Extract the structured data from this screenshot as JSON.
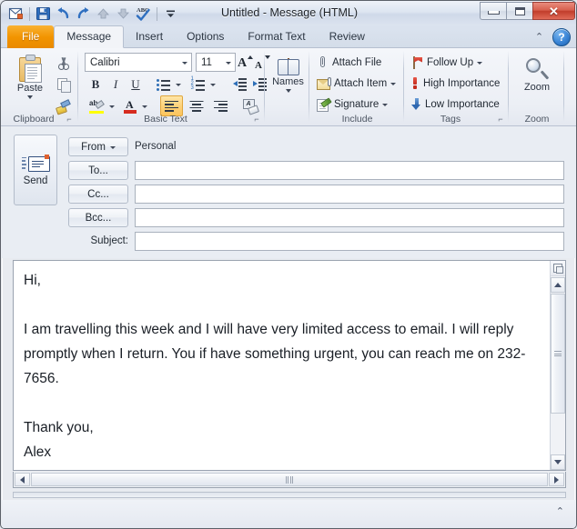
{
  "window": {
    "title": "Untitled  -  Message (HTML)",
    "controls": {
      "minimize": "Minimize",
      "maximize": "Maximize",
      "close": "Close",
      "close_glyph": "✕"
    }
  },
  "quick_access": [
    {
      "name": "outlook-item-icon",
      "title": "Outlook Item"
    },
    {
      "name": "save-icon",
      "title": "Save"
    },
    {
      "name": "undo-icon",
      "title": "Undo"
    },
    {
      "name": "redo-icon",
      "title": "Redo"
    },
    {
      "name": "previous-item-icon",
      "title": "Previous Item"
    },
    {
      "name": "next-item-icon",
      "title": "Next Item"
    },
    {
      "name": "spelling-icon",
      "title": "Spelling & Grammar"
    },
    {
      "name": "customize-qat-icon",
      "title": "Customize Quick Access Toolbar"
    }
  ],
  "tabs": [
    {
      "label": "File",
      "state": "file"
    },
    {
      "label": "Message",
      "state": "selected"
    },
    {
      "label": "Insert",
      "state": "normal"
    },
    {
      "label": "Options",
      "state": "normal"
    },
    {
      "label": "Format Text",
      "state": "normal"
    },
    {
      "label": "Review",
      "state": "normal"
    }
  ],
  "tab_strip_right": {
    "collapse_ribbon": "⌃",
    "help": "?"
  },
  "ribbon": {
    "groups": [
      {
        "label": "Clipboard"
      },
      {
        "label": "Basic Text"
      },
      {
        "label": "Names"
      },
      {
        "label": "Include"
      },
      {
        "label": "Tags"
      },
      {
        "label": "Zoom"
      }
    ],
    "clipboard": {
      "paste_label": "Paste",
      "cut_title": "Cut",
      "copy_title": "Copy",
      "format_painter_title": "Format Painter",
      "dialog_launcher": "⌐"
    },
    "basic_text": {
      "font_name": "Calibri",
      "font_size": "11",
      "dropdown_arrow": "▾",
      "grow_font_title": "Grow Font",
      "shrink_font_title": "Shrink Font",
      "bold": "B",
      "italic": "I",
      "underline": "U",
      "bullets_title": "Bullets",
      "numbering_title": "Numbering",
      "decrease_indent_title": "Decrease Indent",
      "increase_indent_title": "Increase Indent",
      "highlight_label": "ab",
      "font_color_label": "A",
      "align_left_title": "Align Text Left",
      "align_center_title": "Center",
      "align_right_title": "Align Text Right",
      "clear_formatting_title": "Clear Formatting",
      "clear_formatting_label": "A",
      "dialog_launcher": "⌐",
      "highlight_color": "#ffff00",
      "font_color": "#d62b1f",
      "active_alignment": "left"
    },
    "names": {
      "label": "Names",
      "dropdown_arrow": "▾"
    },
    "include": {
      "attach_file": "Attach File",
      "attach_item": "Attach Item",
      "signature": "Signature",
      "dropdown_arrow": "▾"
    },
    "tags": {
      "follow_up": "Follow Up",
      "high_importance": "High Importance",
      "low_importance": "Low Importance",
      "dropdown_arrow": "▾",
      "dialog_launcher": "⌐"
    },
    "zoom": {
      "label": "Zoom"
    }
  },
  "compose": {
    "send_label": "Send",
    "from_label": "From",
    "from_arrow": "▾",
    "from_value": "Personal",
    "to_label": "To...",
    "to_value": "",
    "cc_label": "Cc...",
    "cc_value": "",
    "bcc_label": "Bcc...",
    "bcc_value": "",
    "subject_label": "Subject:",
    "subject_value": "",
    "body": "Hi,\n\nI am travelling this week and I will have very limited access to email. I will reply promptly when I return. You if have something urgent, you can reach me on 232-7656.\n\nThank you,\nAlex"
  },
  "scrollbars": {
    "split_icon": "split-page-icon",
    "up_arrow": "▲",
    "down_arrow": "▼",
    "left_arrow": "◀",
    "right_arrow": "▶"
  },
  "status": {
    "expand_chevron": "⌃"
  }
}
